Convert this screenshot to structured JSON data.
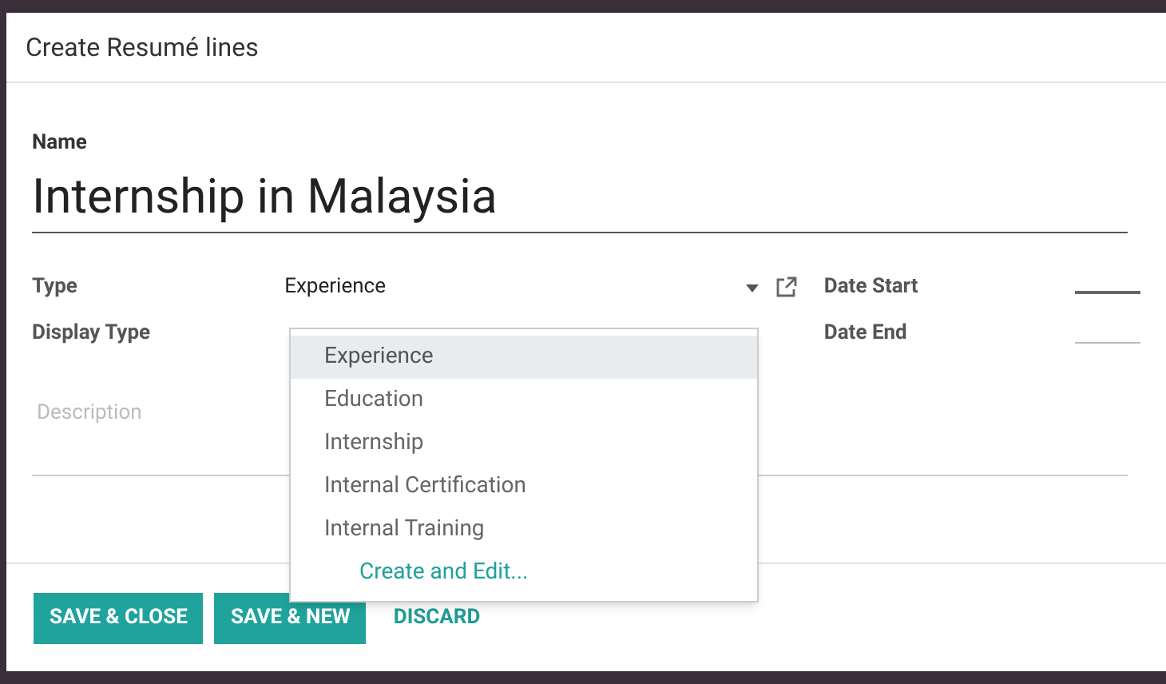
{
  "dialog": {
    "title": "Create Resumé lines"
  },
  "form": {
    "name_label": "Name",
    "name_value": "Internship in Malaysia",
    "type": {
      "label": "Type",
      "value": "Experience",
      "expanded": true
    },
    "display_type": {
      "label": "Display Type"
    },
    "date_start": {
      "label": "Date Start"
    },
    "date_end": {
      "label": "Date End"
    },
    "description": {
      "placeholder": "Description"
    }
  },
  "dropdown": [
    {
      "kind": "option",
      "label": "Experience",
      "selected": true
    },
    {
      "kind": "option",
      "label": "Education",
      "selected": false
    },
    {
      "kind": "option",
      "label": "Internship",
      "selected": false
    },
    {
      "kind": "option",
      "label": "Internal Certification",
      "selected": false
    },
    {
      "kind": "option",
      "label": "Internal Training",
      "selected": false
    },
    {
      "kind": "action",
      "label": "Create and Edit..."
    }
  ],
  "buttons": [
    {
      "kind": "primary",
      "label": "SAVE & CLOSE"
    },
    {
      "kind": "primary",
      "label": "SAVE & NEW"
    },
    {
      "kind": "link",
      "label": "DISCARD"
    }
  ]
}
